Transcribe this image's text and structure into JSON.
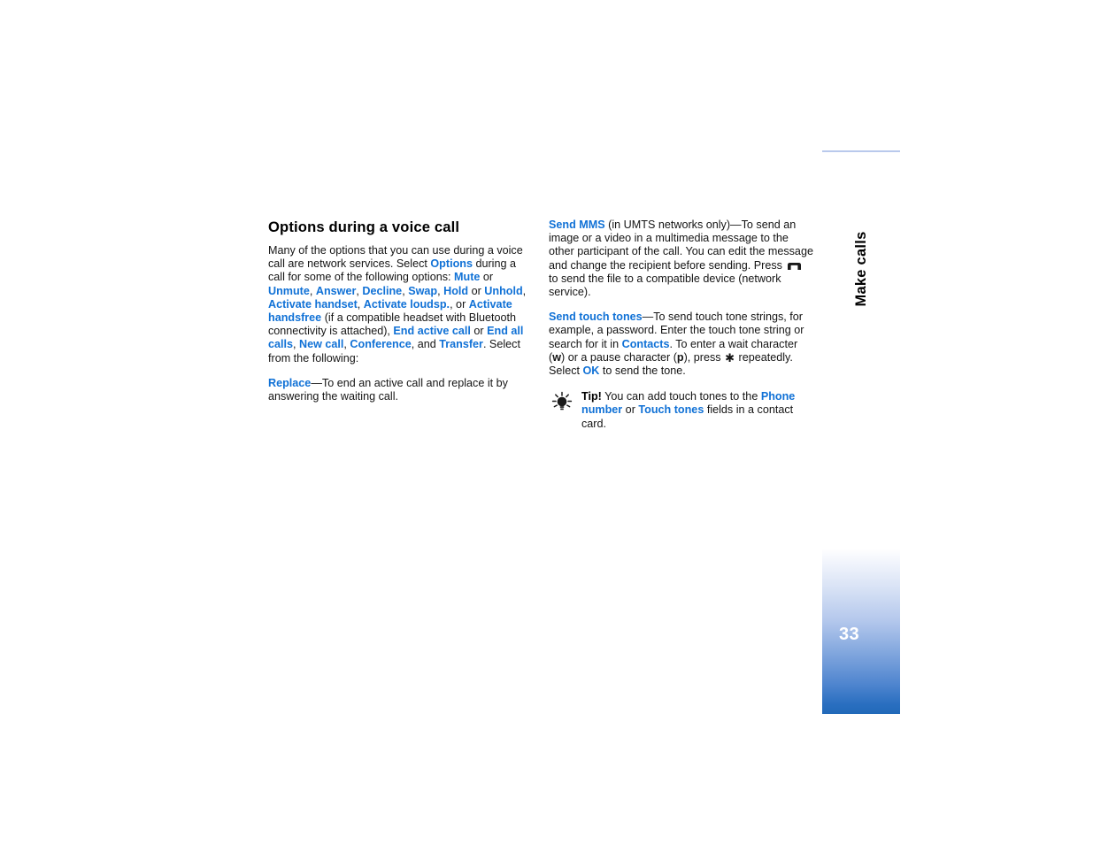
{
  "document": {
    "page_number": "33",
    "chapter_label": "Make calls",
    "accent_blue": "#1071d6",
    "tab_gradient_bottom": "#2169b9",
    "tab_border_top": "#b9c9ec"
  },
  "left_column": {
    "heading": "Options during a voice call",
    "paragraph_1": {
      "t1": "Many of the options that you can use during a voice call are network services. Select ",
      "l1": "Options",
      "t2": " during a call for some of the following options: ",
      "l2": "Mute",
      "t3": " or ",
      "l3": "Unmute",
      "t4": ", ",
      "l4": "Answer",
      "t5": ", ",
      "l5": "Decline",
      "t6": ", ",
      "l6": "Swap",
      "t7": ", ",
      "l7": "Hold",
      "t8": " or ",
      "l8": "Unhold",
      "t9": ", ",
      "l9": "Activate handset",
      "t10": ", ",
      "l10": "Activate loudsp.",
      "t11": ", or ",
      "l11": "Activate handsfree",
      "t12": " (if a compatible headset with Bluetooth connectivity is attached), ",
      "l12": "End active call",
      "t13": " or ",
      "l13": "End all calls",
      "t14": ", ",
      "l14": "New call",
      "t15": ", ",
      "l15": "Conference",
      "t16": ", and ",
      "l16": "Transfer",
      "t17": ". Select from the following:"
    },
    "paragraph_2": {
      "l1": "Replace",
      "t1": "—To end an active call and replace it by answering the waiting call."
    }
  },
  "right_column": {
    "paragraph_1": {
      "l1": "Send MMS",
      "t1": " (in UMTS networks only)—To send an image or a video in a multimedia message to the other participant of the call. You can edit the message and change the recipient before sending. Press ",
      "icon": "send-key-icon",
      "t2": " to send the file to a compatible device (network service)."
    },
    "paragraph_2": {
      "l1": "Send touch tones",
      "t1": "—To send touch tone strings, for example, a password. Enter the touch tone string or search for it in ",
      "l2": "Contacts",
      "t2": ". To enter a wait character (",
      "k1": "w",
      "t3": ") or a pause character (",
      "k2": "p",
      "t4": "), press ",
      "star": "✱",
      "t5": " repeatedly. Select ",
      "l3": "OK",
      "t6": " to send the tone."
    },
    "tip": {
      "icon": "lightbulb-icon",
      "lead": "Tip!",
      "t1": " You can add touch tones to the ",
      "l1": "Phone number",
      "t2": " or ",
      "l2": "Touch tones",
      "t3": " fields in a contact card."
    }
  }
}
